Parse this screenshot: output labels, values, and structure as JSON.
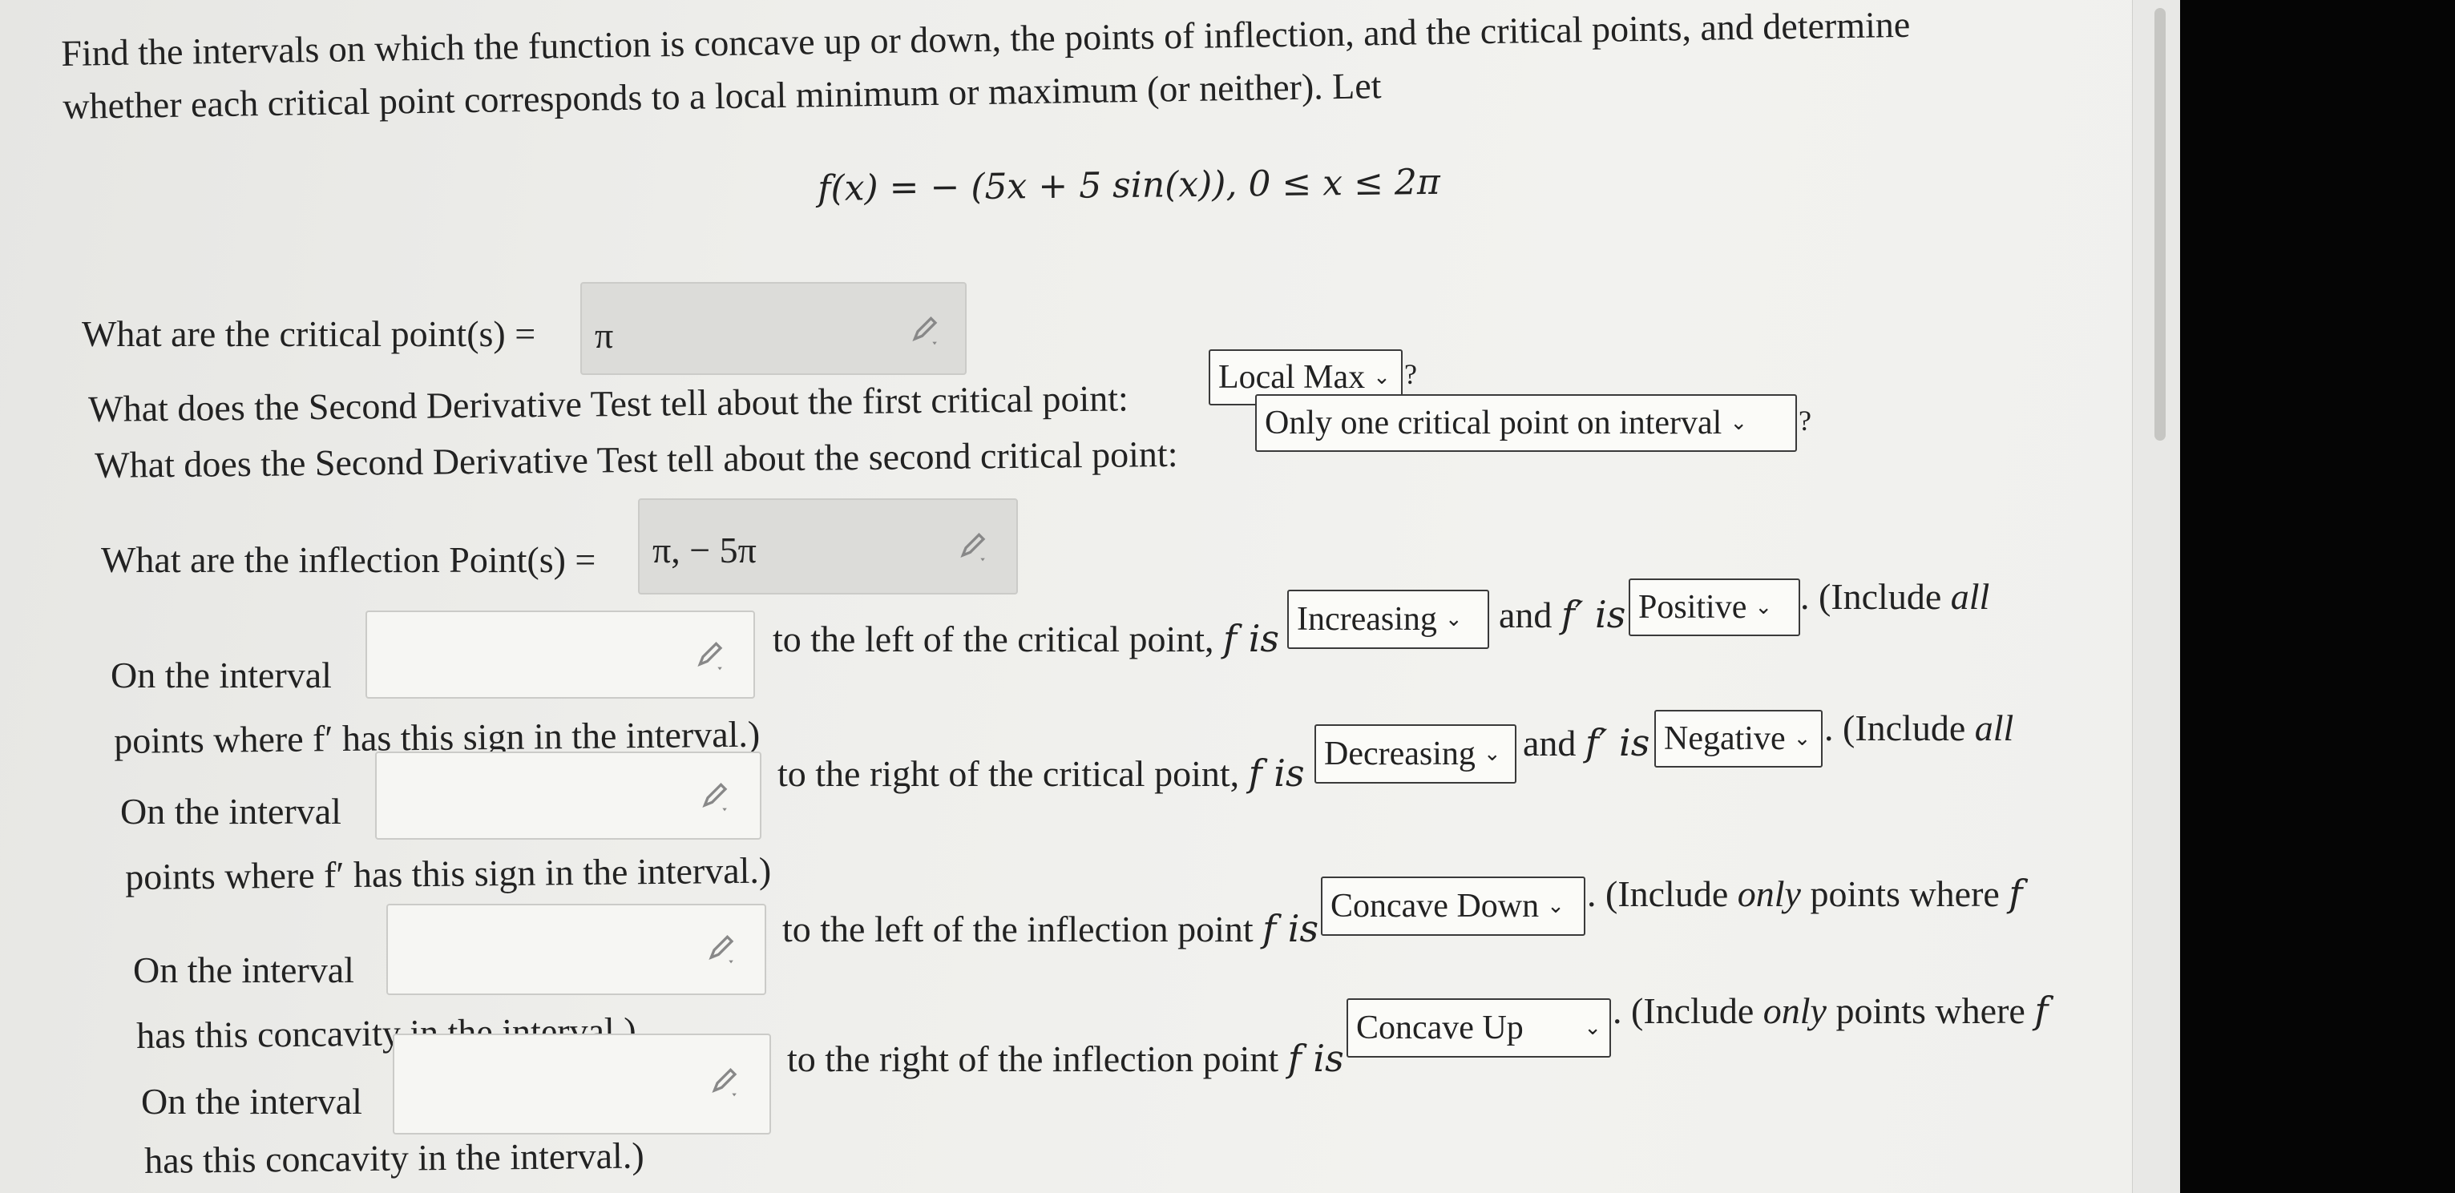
{
  "intro": {
    "line1": "Find the intervals on which the function is concave up or down, the points of inflection, and the critical points, and determine",
    "line2": "whether each critical point corresponds to a local minimum or maximum (or neither). Let",
    "formula": "f(x) = − (5x + 5 sin(x)),  0 ≤ x ≤ 2π"
  },
  "critical": {
    "label": "What are the critical point(s) =",
    "value": "π"
  },
  "sdt_first": {
    "label": "What does the Second Derivative Test tell about the first critical point:",
    "selected": "Local Max",
    "help": "?"
  },
  "sdt_second": {
    "label": "What does the Second Derivative Test tell about the second critical point:",
    "selected": "Only one critical point on interval",
    "help": "?"
  },
  "inflection": {
    "label": "What are the inflection Point(s) =",
    "value": "π, − 5π"
  },
  "rows": {
    "r1": {
      "start": "On the interval",
      "mid": "to the left of the critical point,",
      "f_is": "f is",
      "sel1": "Increasing",
      "and": "and",
      "fprime_is": "f′ is",
      "sel2": "Positive",
      "tail_a": ". (Include",
      "tail_b": "all",
      "cont": "points where f′ has this sign in the interval.)"
    },
    "r2": {
      "start": "On the interval",
      "mid": "to the right of the critical point,",
      "f_is": "f is",
      "sel1": "Decreasing",
      "and": "and",
      "fprime_is": "f′ is",
      "sel2": "Negative",
      "tail_a": ". (Include",
      "tail_b": "all",
      "cont": "points where f′ has this sign in the interval.)"
    },
    "r3": {
      "start": "On the interval",
      "mid": "to the left of the inflection point",
      "f_is": "f is",
      "sel1": "Concave Down",
      "tail_a": ". (Include",
      "tail_b": "only",
      "tail_c": "points where",
      "tail_f": "f",
      "cont": "has this concavity in the interval.)"
    },
    "r4": {
      "start": "On the interval",
      "mid": "to the right of the inflection point",
      "f_is": "f is",
      "sel1": "Concave Up",
      "tail_a": ". (Include",
      "tail_b": "only",
      "tail_c": "points where",
      "tail_f": "f",
      "cont": "has this concavity in the interval.)"
    }
  },
  "icons": {
    "pencil": "pencil-edit-icon",
    "chevron": "chevron-down-icon"
  }
}
